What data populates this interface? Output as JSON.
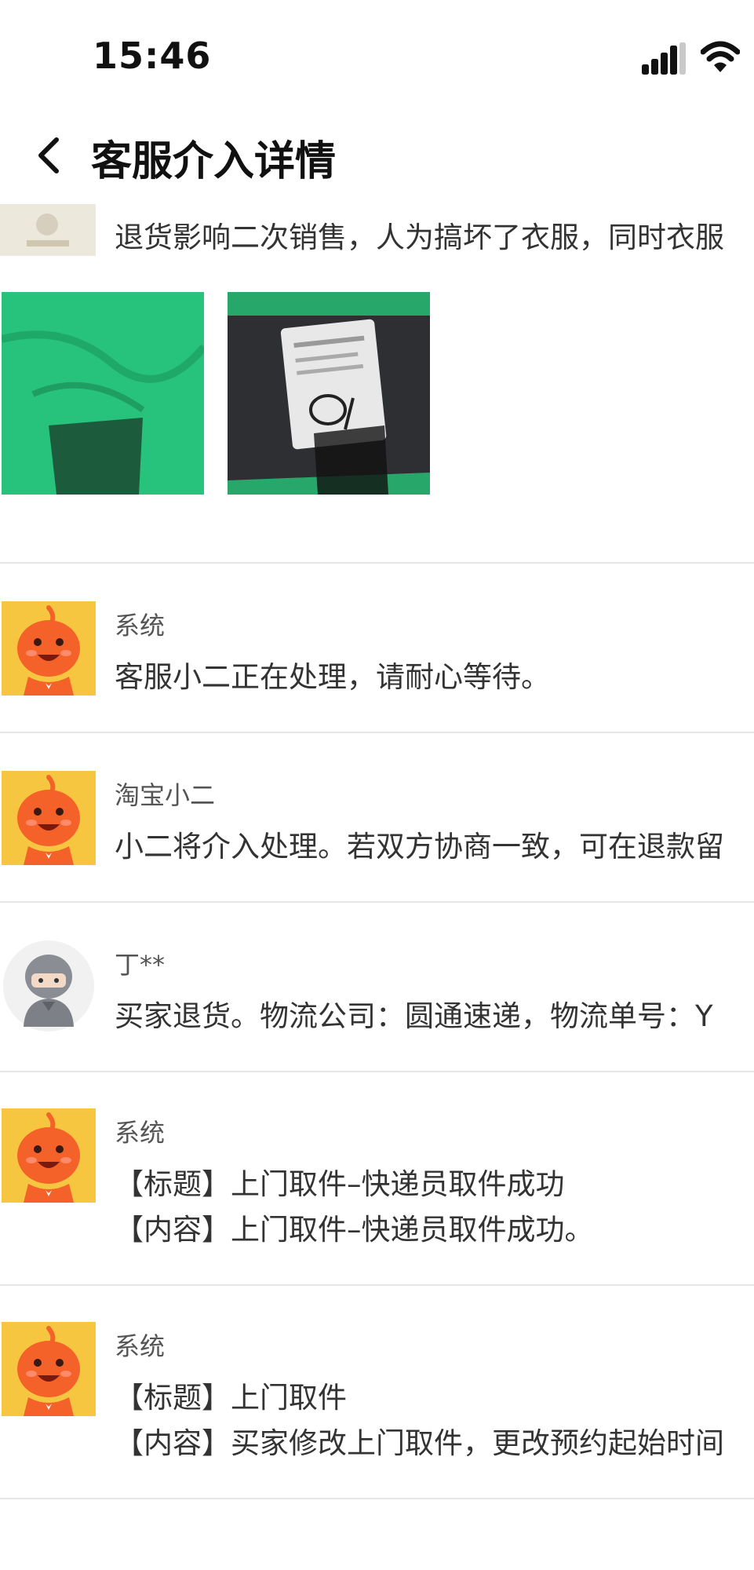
{
  "status_bar": {
    "time": "15:46",
    "signal_icon": "cellular-signal-icon",
    "wifi_icon": "wifi-icon"
  },
  "nav": {
    "back_icon": "chevron-left-icon",
    "title": "客服介入详情"
  },
  "top_entry": {
    "text": "退货影响二次销售，人为搞坏了衣服，同时衣服"
  },
  "messages": [
    {
      "sender": "系统",
      "avatar": "taobao-mascot-avatar",
      "lines": [
        "客服小二正在处理，请耐心等待。"
      ]
    },
    {
      "sender": "淘宝小二",
      "avatar": "taobao-mascot-avatar",
      "lines": [
        "小二将介入处理。若双方协商一致，可在退款留"
      ]
    },
    {
      "sender": "丁**",
      "avatar": "buyer-avatar",
      "lines": [
        "买家退货。物流公司：圆通速递，物流单号：Y"
      ]
    },
    {
      "sender": "系统",
      "avatar": "taobao-mascot-avatar",
      "lines": [
        "【标题】上门取件–快递员取件成功",
        "【内容】上门取件–快递员取件成功。"
      ]
    },
    {
      "sender": "系统",
      "avatar": "taobao-mascot-avatar",
      "lines": [
        "【标题】上门取件",
        "【内容】买家修改上门取件，更改预约起始时间"
      ]
    }
  ],
  "colors": {
    "mascot_bg": "#f7c640",
    "mascot_body": "#f4622a",
    "green_photo": "#27c27b",
    "divider": "#e5e5e5"
  }
}
